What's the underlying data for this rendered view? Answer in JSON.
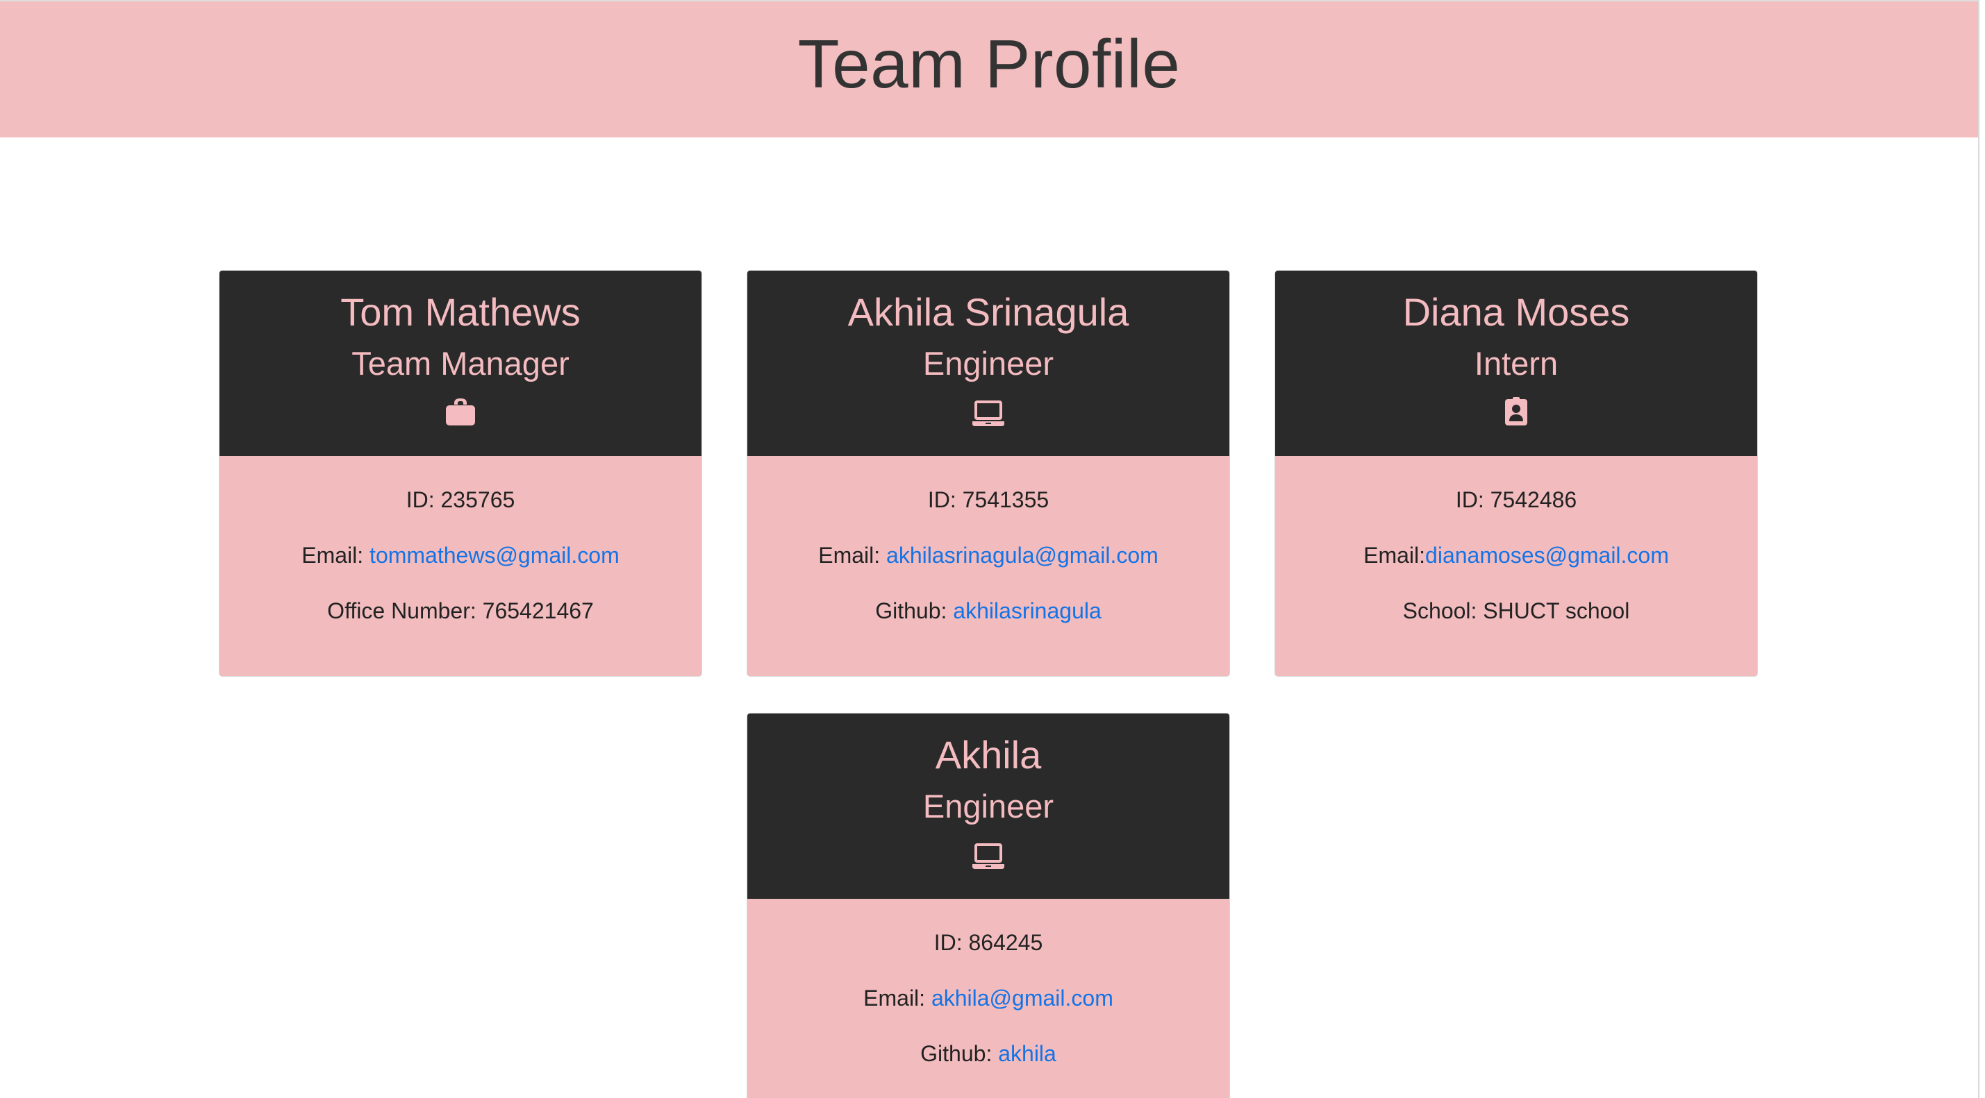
{
  "header": {
    "title": "Team Profile"
  },
  "theme": {
    "banner_color": "#f3bec0",
    "card_head_color": "#2a2a2a",
    "card_body_color": "#f2bcbe",
    "accent_pink": "#f4bcc0",
    "link_color": "#1473e6"
  },
  "employees": [
    {
      "name": "Tom Mathews",
      "role": "Team Manager",
      "icon": "briefcase-icon",
      "id_label": "ID: ",
      "id_value": "235765",
      "email_label": "Email: ",
      "email_value": "tommathews@gmail.com",
      "extra_label": "Office Number: ",
      "extra_value": "765421467"
    },
    {
      "name": "Akhila Srinagula",
      "role": "Engineer",
      "icon": "laptop-icon",
      "id_label": "ID: ",
      "id_value": "7541355",
      "email_label": "Email: ",
      "email_value": "akhilasrinagula@gmail.com",
      "extra_label": "Github: ",
      "extra_value": "akhilasrinagula"
    },
    {
      "name": "Diana Moses",
      "role": "Intern",
      "icon": "id-badge-icon",
      "id_label": "ID: ",
      "id_value": "7542486",
      "email_label": "Email:",
      "email_value": "dianamoses@gmail.com",
      "extra_label": "School: ",
      "extra_value": "SHUCT school"
    },
    {
      "name": "Akhila",
      "role": "Engineer",
      "icon": "laptop-icon",
      "id_label": "ID: ",
      "id_value": "864245",
      "email_label": "Email: ",
      "email_value": "akhila@gmail.com",
      "extra_label": "Github: ",
      "extra_value": "akhila"
    }
  ]
}
